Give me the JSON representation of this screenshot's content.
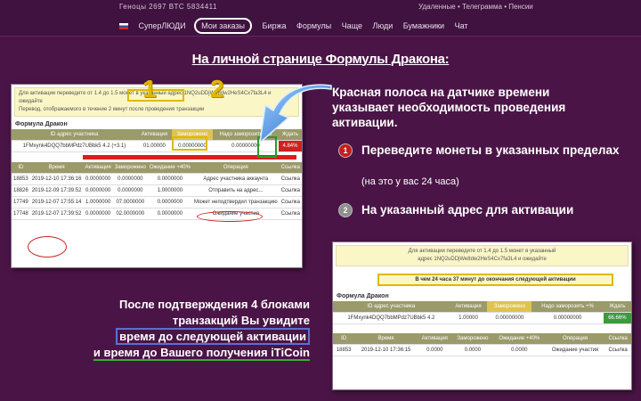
{
  "topbar": {
    "left_text": "Геноцы  2697 BTC  5834411",
    "right_text": "Удаленные  •  Телеграмма  •  Пенсии",
    "nav": [
      "СуперЛЮДИ",
      "Мои заказы",
      "Биржа",
      "Формулы",
      "Чаще",
      "Люди",
      "Бумажники",
      "Чат"
    ]
  },
  "headline": "На личной странице Формулы Дракона:",
  "callout_numbers": [
    "1",
    "2"
  ],
  "right_panel": {
    "intro": "Красная полоса на датчике времени указывает необходимость проведения активации.",
    "step1_num": "1",
    "step1_text": "Переведите монеты в указанных пределах",
    "step1_note": "(на это у вас 24 часа)",
    "step2_num": "2",
    "step2_text": "На указанный адрес для активации"
  },
  "bottom_text": {
    "line1": "После подтверждения 4 блоками",
    "line2": "транзакций Вы увидите",
    "line3": "время до следующей активации",
    "line4": "и время до Вашего получения iTiCoin"
  },
  "shot1": {
    "banner1": "Для активации переведите от 1.4 до 1.5 монет в указанный адрес 1NQ2uDDjWe8dw2HeS4Cx7fa3L4 и ожидайте",
    "banner2": "Перевод, отображаемого в течение 2 минут после проведения транзакции",
    "title": "Формула Дракон",
    "columns": [
      "ID адрес участника",
      "Активация",
      "Заморожено",
      "Надо заморозить +%",
      "Ждать"
    ],
    "row": [
      "1FMxynk4DQQ7bbMPdz7UBbk5  4.2 (+3.1)",
      "01.00000",
      "0.00000000",
      "0.00000000",
      "4.84%"
    ],
    "table2_columns": [
      "ID",
      "Время",
      "Активация",
      "Заморожено",
      "Ожидание +40%",
      "Операция",
      "Ссылка"
    ],
    "table2_rows": [
      [
        "18853",
        "2019-12-10 17:36:16",
        "0.0000000",
        "0.0000000",
        "0.0000000",
        "Адрес участника аккаунта",
        "Ссылка"
      ],
      [
        "18826",
        "2019-12-09 17:39:52",
        "0.0000000",
        "0.0000000",
        "1.0000000",
        "Отправить на адрес...",
        "Ссылка"
      ],
      [
        "17749",
        "2019-12-07 17:55:14",
        "1.0000000",
        "07.0000000",
        "0.0000000",
        "Может неподтвердил транзакцию",
        "Ссылка"
      ],
      [
        "17748",
        "2019-12-07 17:39:52",
        "0.0000000",
        "02.0000000",
        "0.0000000",
        "Ожидание участия",
        "Ссылка"
      ]
    ]
  },
  "shot2": {
    "banner1": "Для активации переведите от 1.4 до 1.5 монет в указанный",
    "banner2": "адрес 1NQ2uDDjWe8dw2HeS4Cx7fa3L4 и ожидайте",
    "notice": "В чем 24 часа 37 минут до окончания следующей активации",
    "title": "Формула Дракон",
    "columns": [
      "ID адрес участника",
      "Активация",
      "Заморожено",
      "Надо заморозить +%",
      "Ждать"
    ],
    "row": [
      "1FMxynk4DQQ7bbMPdz7UBbk5  4.2",
      "1.00000",
      "0.00000000",
      "0.00000000",
      "66.66%"
    ],
    "table2_columns": [
      "ID",
      "Время",
      "Активация",
      "Заморожено",
      "Ожидание +40%",
      "Операция",
      "Ссылка"
    ],
    "table2_row": [
      "18853",
      "2019-12-10 17:36:15",
      "0.0000",
      "0.0000",
      "0.0000",
      "Ожидание участия",
      "Ссылка"
    ]
  },
  "colors": {
    "background": "#4a1546",
    "highlight_yellow": "#e0b800",
    "highlight_green": "#2a9a2a",
    "highlight_blue": "#5b6fd4",
    "progress_red": "#d81e1e",
    "progress_green": "#3b9b3b"
  }
}
